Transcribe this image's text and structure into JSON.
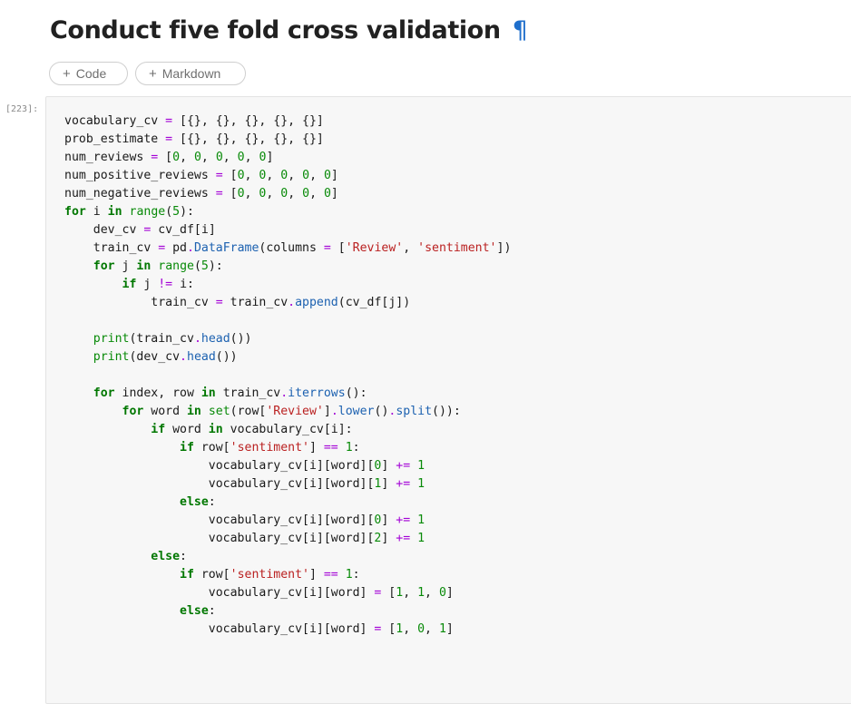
{
  "heading": {
    "text": "Conduct five fold cross validation",
    "anchor": "¶"
  },
  "add_buttons": {
    "code_label": "Code",
    "markdown_label": "Markdown",
    "plus_icon": "plus-icon"
  },
  "cell": {
    "prompt": "[223]:",
    "colors": {
      "keyword": "#007700",
      "operator": "#a300d6",
      "number": "#088a08",
      "string": "#ba2121",
      "function": "#1c61b0",
      "text": "#1a1a1a"
    },
    "lines": [
      [
        [
          "p",
          "vocabulary_cv "
        ],
        [
          "o",
          "="
        ],
        [
          "p",
          " [{}, {}, {}, {}, {}]"
        ]
      ],
      [
        [
          "p",
          "prob_estimate "
        ],
        [
          "o",
          "="
        ],
        [
          "p",
          " [{}, {}, {}, {}, {}]"
        ]
      ],
      [
        [
          "p",
          "num_reviews "
        ],
        [
          "o",
          "="
        ],
        [
          "p",
          " ["
        ],
        [
          "n",
          "0"
        ],
        [
          "p",
          ", "
        ],
        [
          "n",
          "0"
        ],
        [
          "p",
          ", "
        ],
        [
          "n",
          "0"
        ],
        [
          "p",
          ", "
        ],
        [
          "n",
          "0"
        ],
        [
          "p",
          ", "
        ],
        [
          "n",
          "0"
        ],
        [
          "p",
          "]"
        ]
      ],
      [
        [
          "p",
          "num_positive_reviews "
        ],
        [
          "o",
          "="
        ],
        [
          "p",
          " ["
        ],
        [
          "n",
          "0"
        ],
        [
          "p",
          ", "
        ],
        [
          "n",
          "0"
        ],
        [
          "p",
          ", "
        ],
        [
          "n",
          "0"
        ],
        [
          "p",
          ", "
        ],
        [
          "n",
          "0"
        ],
        [
          "p",
          ", "
        ],
        [
          "n",
          "0"
        ],
        [
          "p",
          "]"
        ]
      ],
      [
        [
          "p",
          "num_negative_reviews "
        ],
        [
          "o",
          "="
        ],
        [
          "p",
          " ["
        ],
        [
          "n",
          "0"
        ],
        [
          "p",
          ", "
        ],
        [
          "n",
          "0"
        ],
        [
          "p",
          ", "
        ],
        [
          "n",
          "0"
        ],
        [
          "p",
          ", "
        ],
        [
          "n",
          "0"
        ],
        [
          "p",
          ", "
        ],
        [
          "n",
          "0"
        ],
        [
          "p",
          "]"
        ]
      ],
      [
        [
          "k",
          "for"
        ],
        [
          "p",
          " i "
        ],
        [
          "ow",
          "in"
        ],
        [
          "p",
          " "
        ],
        [
          "n",
          "range"
        ],
        [
          "p",
          "("
        ],
        [
          "n",
          "5"
        ],
        [
          "p",
          "):"
        ]
      ],
      [
        [
          "p",
          "    dev_cv "
        ],
        [
          "o",
          "="
        ],
        [
          "p",
          " cv_df[i]"
        ]
      ],
      [
        [
          "p",
          "    train_cv "
        ],
        [
          "o",
          "="
        ],
        [
          "p",
          " pd"
        ],
        [
          "o",
          "."
        ],
        [
          "f",
          "DataFrame"
        ],
        [
          "p",
          "(columns "
        ],
        [
          "o",
          "="
        ],
        [
          "p",
          " ["
        ],
        [
          "s",
          "'Review'"
        ],
        [
          "p",
          ", "
        ],
        [
          "s",
          "'sentiment'"
        ],
        [
          "p",
          "])"
        ]
      ],
      [
        [
          "k",
          "    for"
        ],
        [
          "p",
          " j "
        ],
        [
          "ow",
          "in"
        ],
        [
          "p",
          " "
        ],
        [
          "n",
          "range"
        ],
        [
          "p",
          "("
        ],
        [
          "n",
          "5"
        ],
        [
          "p",
          "):"
        ]
      ],
      [
        [
          "k",
          "        if"
        ],
        [
          "p",
          " j "
        ],
        [
          "o",
          "!="
        ],
        [
          "p",
          " i:"
        ]
      ],
      [
        [
          "p",
          "            train_cv "
        ],
        [
          "o",
          "="
        ],
        [
          "p",
          " train_cv"
        ],
        [
          "o",
          "."
        ],
        [
          "f",
          "append"
        ],
        [
          "p",
          "(cv_df[j])"
        ]
      ],
      [],
      [
        [
          "p",
          "    "
        ],
        [
          "n",
          "print"
        ],
        [
          "p",
          "(train_cv"
        ],
        [
          "o",
          "."
        ],
        [
          "f",
          "head"
        ],
        [
          "p",
          "())"
        ]
      ],
      [
        [
          "p",
          "    "
        ],
        [
          "n",
          "print"
        ],
        [
          "p",
          "(dev_cv"
        ],
        [
          "o",
          "."
        ],
        [
          "f",
          "head"
        ],
        [
          "p",
          "())"
        ]
      ],
      [],
      [
        [
          "k",
          "    for"
        ],
        [
          "p",
          " index, row "
        ],
        [
          "ow",
          "in"
        ],
        [
          "p",
          " train_cv"
        ],
        [
          "o",
          "."
        ],
        [
          "f",
          "iterrows"
        ],
        [
          "p",
          "():"
        ]
      ],
      [
        [
          "k",
          "        for"
        ],
        [
          "p",
          " word "
        ],
        [
          "ow",
          "in"
        ],
        [
          "p",
          " "
        ],
        [
          "n",
          "set"
        ],
        [
          "p",
          "(row["
        ],
        [
          "s",
          "'Review'"
        ],
        [
          "p",
          "]"
        ],
        [
          "o",
          "."
        ],
        [
          "f",
          "lower"
        ],
        [
          "p",
          "()"
        ],
        [
          "o",
          "."
        ],
        [
          "f",
          "split"
        ],
        [
          "p",
          "()):"
        ]
      ],
      [
        [
          "k",
          "            if"
        ],
        [
          "p",
          " word "
        ],
        [
          "ow",
          "in"
        ],
        [
          "p",
          " vocabulary_cv[i]:"
        ]
      ],
      [
        [
          "k",
          "                if"
        ],
        [
          "p",
          " row["
        ],
        [
          "s",
          "'sentiment'"
        ],
        [
          "p",
          "] "
        ],
        [
          "o",
          "=="
        ],
        [
          "p",
          " "
        ],
        [
          "n",
          "1"
        ],
        [
          "p",
          ":"
        ]
      ],
      [
        [
          "p",
          "                    vocabulary_cv[i][word]["
        ],
        [
          "n",
          "0"
        ],
        [
          "p",
          "] "
        ],
        [
          "o",
          "+="
        ],
        [
          "p",
          " "
        ],
        [
          "n",
          "1"
        ]
      ],
      [
        [
          "p",
          "                    vocabulary_cv[i][word]["
        ],
        [
          "n",
          "1"
        ],
        [
          "p",
          "] "
        ],
        [
          "o",
          "+="
        ],
        [
          "p",
          " "
        ],
        [
          "n",
          "1"
        ]
      ],
      [
        [
          "k",
          "                else"
        ],
        [
          "p",
          ":"
        ]
      ],
      [
        [
          "p",
          "                    vocabulary_cv[i][word]["
        ],
        [
          "n",
          "0"
        ],
        [
          "p",
          "] "
        ],
        [
          "o",
          "+="
        ],
        [
          "p",
          " "
        ],
        [
          "n",
          "1"
        ]
      ],
      [
        [
          "p",
          "                    vocabulary_cv[i][word]["
        ],
        [
          "n",
          "2"
        ],
        [
          "p",
          "] "
        ],
        [
          "o",
          "+="
        ],
        [
          "p",
          " "
        ],
        [
          "n",
          "1"
        ]
      ],
      [
        [
          "k",
          "            else"
        ],
        [
          "p",
          ":"
        ]
      ],
      [
        [
          "k",
          "                if"
        ],
        [
          "p",
          " row["
        ],
        [
          "s",
          "'sentiment'"
        ],
        [
          "p",
          "] "
        ],
        [
          "o",
          "=="
        ],
        [
          "p",
          " "
        ],
        [
          "n",
          "1"
        ],
        [
          "p",
          ":"
        ]
      ],
      [
        [
          "p",
          "                    vocabulary_cv[i][word] "
        ],
        [
          "o",
          "="
        ],
        [
          "p",
          " ["
        ],
        [
          "n",
          "1"
        ],
        [
          "p",
          ", "
        ],
        [
          "n",
          "1"
        ],
        [
          "p",
          ", "
        ],
        [
          "n",
          "0"
        ],
        [
          "p",
          "]"
        ]
      ],
      [
        [
          "k",
          "                else"
        ],
        [
          "p",
          ":"
        ]
      ],
      [
        [
          "p",
          "                    vocabulary_cv[i][word] "
        ],
        [
          "o",
          "="
        ],
        [
          "p",
          " ["
        ],
        [
          "n",
          "1"
        ],
        [
          "p",
          ", "
        ],
        [
          "n",
          "0"
        ],
        [
          "p",
          ", "
        ],
        [
          "n",
          "1"
        ],
        [
          "p",
          "]"
        ]
      ]
    ]
  }
}
